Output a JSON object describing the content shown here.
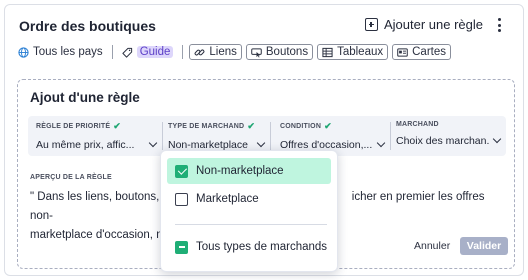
{
  "header": {
    "title": "Ordre des boutiques",
    "add_rule_label": "Ajouter une règle"
  },
  "toolbar": {
    "countries": "Tous les pays",
    "guide": "Guide",
    "links": "Liens",
    "buttons": "Boutons",
    "tables": "Tableaux",
    "cards": "Cartes"
  },
  "rule_form": {
    "title": "Ajout d'une règle",
    "filters": [
      {
        "label": "RÈGLE DE PRIORITÉ",
        "value": "Au même prix, affic...",
        "validated": true
      },
      {
        "label": "TYPE DE MARCHAND",
        "value": "Non-marketplace",
        "validated": true
      },
      {
        "label": "CONDITION",
        "value": "Offres d'occasion,...",
        "validated": true
      },
      {
        "label": "MARCHAND",
        "value": "Choix des marchan...",
        "validated": false
      }
    ],
    "preview_label": "APERÇU DE LA RÈGLE",
    "preview_line1_start": "\" Dans les liens, boutons, t",
    "preview_line1_end": "icher en premier les offres non-",
    "preview_line2_start": "marketplace d'occasion, n",
    "cancel_label": "Annuler",
    "validate_label": "Valider"
  },
  "dropdown": {
    "options": [
      {
        "label": "Non-marketplace",
        "state": "checked"
      },
      {
        "label": "Marketplace",
        "state": "unchecked"
      }
    ],
    "all_option": {
      "label": "Tous types de marchands",
      "state": "indeterminate"
    }
  },
  "colors": {
    "accent_green": "#1fae76",
    "selected_bg": "#bff5df",
    "guide_bg": "#ddd6fb",
    "guide_text": "#5d40c8",
    "validate_bg": "#a8b0c8"
  }
}
